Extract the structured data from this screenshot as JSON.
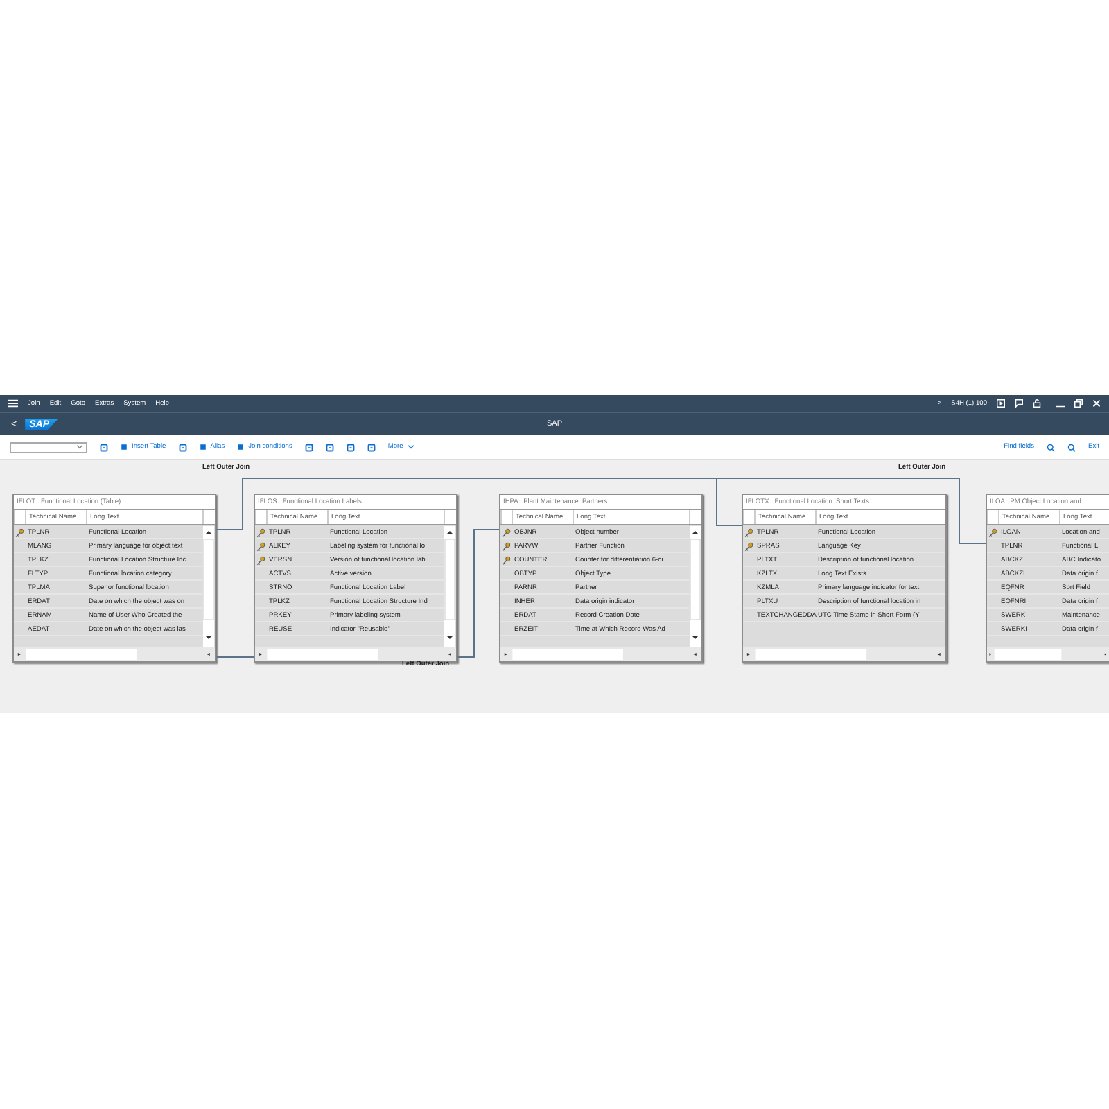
{
  "menu_bar": {
    "items": [
      "Join",
      "Edit",
      "Goto",
      "Extras",
      "System",
      "Help"
    ],
    "expand": ">",
    "system_info": "S4H (1) 100"
  },
  "header": {
    "back": "<",
    "logo": "SAP",
    "title": "SAP"
  },
  "toolbar": {
    "left": [
      {
        "kind": "dropdown"
      },
      {
        "kind": "icon"
      },
      {
        "kind": "text",
        "label": "Insert Table"
      },
      {
        "kind": "icon"
      },
      {
        "kind": "text",
        "label": "Alias"
      },
      {
        "kind": "text",
        "label": "Join conditions"
      },
      {
        "kind": "icon"
      },
      {
        "kind": "icon"
      },
      {
        "kind": "icon"
      },
      {
        "kind": "icon"
      },
      {
        "kind": "more",
        "label": "More"
      }
    ],
    "right": [
      {
        "kind": "text",
        "label": "Find fields"
      },
      {
        "kind": "icon"
      },
      {
        "kind": "icon"
      },
      {
        "kind": "text",
        "label": "Exit"
      }
    ]
  },
  "joins": [
    {
      "label": "Left Outer Join"
    },
    {
      "label": "Left Outer Join"
    },
    {
      "label": "Left Outer Join"
    }
  ],
  "tables": [
    {
      "title": "IFLOT : Functional Location (Table)",
      "columns": [
        "Technical Name",
        "Long Text"
      ],
      "scrollbar": true,
      "rows": [
        {
          "key": true,
          "name": "TPLNR",
          "text": "Functional Location"
        },
        {
          "key": false,
          "name": "MLANG",
          "text": "Primary language for object text"
        },
        {
          "key": false,
          "name": "TPLKZ",
          "text": "Functional Location Structure Inc"
        },
        {
          "key": false,
          "name": "FLTYP",
          "text": "Functional location category"
        },
        {
          "key": false,
          "name": "TPLMA",
          "text": "Superior functional location"
        },
        {
          "key": false,
          "name": "ERDAT",
          "text": "Date on which the object was on"
        },
        {
          "key": false,
          "name": "ERNAM",
          "text": "Name of User Who Created the"
        },
        {
          "key": false,
          "name": "AEDAT",
          "text": "Date on which the object was las"
        }
      ]
    },
    {
      "title": "IFLOS : Functional Location Labels",
      "columns": [
        "Technical Name",
        "Long Text"
      ],
      "scrollbar": true,
      "rows": [
        {
          "key": true,
          "name": "TPLNR",
          "text": "Functional Location"
        },
        {
          "key": true,
          "name": "ALKEY",
          "text": "Labeling system for functional lo"
        },
        {
          "key": true,
          "name": "VERSN",
          "text": "Version of functional location lab"
        },
        {
          "key": false,
          "name": "ACTVS",
          "text": "Active version"
        },
        {
          "key": false,
          "name": "STRNO",
          "text": "Functional Location Label"
        },
        {
          "key": false,
          "name": "TPLKZ",
          "text": "Functional Location Structure Ind"
        },
        {
          "key": false,
          "name": "PRKEY",
          "text": "Primary labeling system"
        },
        {
          "key": false,
          "name": "REUSE",
          "text": "Indicator \"Reusable\""
        }
      ]
    },
    {
      "title": "IHPA : Plant Maintenance: Partners",
      "columns": [
        "Technical Name",
        "Long Text"
      ],
      "scrollbar": true,
      "rows": [
        {
          "key": true,
          "name": "OBJNR",
          "text": "Object number"
        },
        {
          "key": true,
          "name": "PARVW",
          "text": "Partner Function"
        },
        {
          "key": true,
          "name": "COUNTER",
          "text": "Counter for differentiation 6-di"
        },
        {
          "key": false,
          "name": "OBTYP",
          "text": "Object Type"
        },
        {
          "key": false,
          "name": "PARNR",
          "text": "Partner"
        },
        {
          "key": false,
          "name": "INHER",
          "text": "Data origin indicator"
        },
        {
          "key": false,
          "name": "ERDAT",
          "text": "Record Creation Date"
        },
        {
          "key": false,
          "name": "ERZEIT",
          "text": "Time at Which Record Was Ad"
        }
      ]
    },
    {
      "title": "IFLOTX : Functional Location: Short Texts",
      "columns": [
        "Technical Name",
        "Long Text"
      ],
      "scrollbar": false,
      "rows": [
        {
          "key": true,
          "name": "TPLNR",
          "text": "Functional Location"
        },
        {
          "key": true,
          "name": "SPRAS",
          "text": "Language Key"
        },
        {
          "key": false,
          "name": "PLTXT",
          "text": "Description of functional location"
        },
        {
          "key": false,
          "name": "KZLTX",
          "text": "Long Text Exists"
        },
        {
          "key": false,
          "name": "KZMLA",
          "text": "Primary language indicator for text"
        },
        {
          "key": false,
          "name": "PLTXU",
          "text": "Description of functional location in"
        },
        {
          "key": false,
          "name": "TEXTCHANGEDDA",
          "text": "UTC Time Stamp in Short Form (Y'"
        }
      ]
    },
    {
      "title": "ILOA : PM Object Location and",
      "columns": [
        "Technical Name",
        "Long Text"
      ],
      "scrollbar": false,
      "rows": [
        {
          "key": true,
          "name": "ILOAN",
          "text": "Location and"
        },
        {
          "key": false,
          "name": "TPLNR",
          "text": "Functional L"
        },
        {
          "key": false,
          "name": "ABCKZ",
          "text": "ABC Indicato"
        },
        {
          "key": false,
          "name": "ABCKZI",
          "text": "Data origin f"
        },
        {
          "key": false,
          "name": "EQFNR",
          "text": "Sort Field"
        },
        {
          "key": false,
          "name": "EQFNRI",
          "text": "Data origin f"
        },
        {
          "key": false,
          "name": "SWERK",
          "text": "Maintenance"
        },
        {
          "key": false,
          "name": "SWERKI",
          "text": "Data origin f"
        }
      ]
    }
  ]
}
